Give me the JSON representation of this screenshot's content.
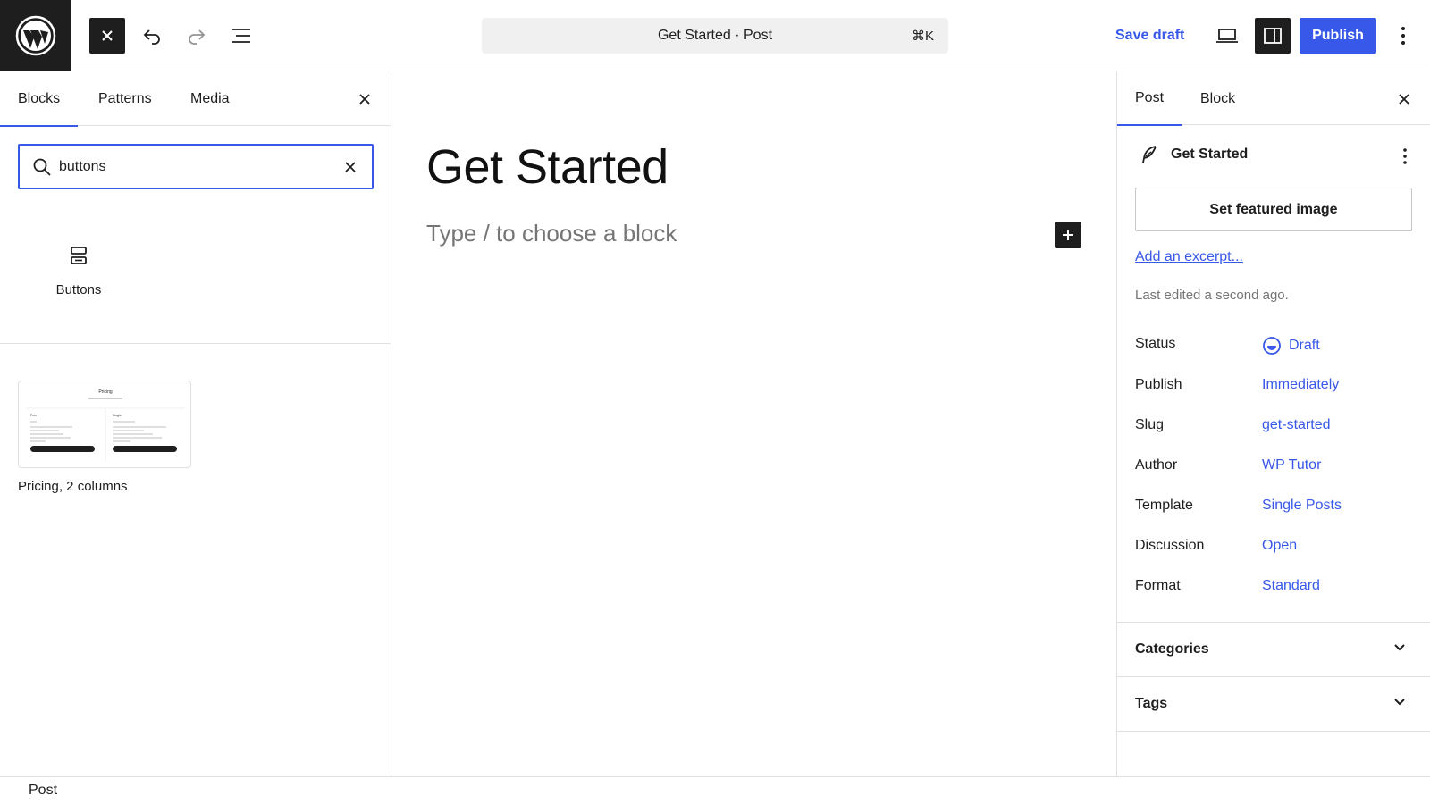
{
  "topbar": {
    "doc_title": "Get Started · Post",
    "shortcut": "⌘K",
    "save_draft": "Save draft",
    "publish": "Publish"
  },
  "inserter": {
    "tabs": [
      "Blocks",
      "Patterns",
      "Media"
    ],
    "search_value": "buttons",
    "block_result": "Buttons",
    "pattern_result": "Pricing, 2 columns",
    "pattern_preview": {
      "title": "Pricing",
      "col1": "Free",
      "col2": "Single"
    }
  },
  "editor": {
    "title": "Get Started",
    "placeholder": "Type / to choose a block"
  },
  "settings": {
    "tabs": [
      "Post",
      "Block"
    ],
    "post_title": "Get Started",
    "featured_image": "Set featured image",
    "excerpt_link": "Add an excerpt...",
    "last_edited": "Last edited a second ago.",
    "meta": [
      {
        "label": "Status",
        "value": "Draft"
      },
      {
        "label": "Publish",
        "value": "Immediately"
      },
      {
        "label": "Slug",
        "value": "get-started"
      },
      {
        "label": "Author",
        "value": "WP Tutor"
      },
      {
        "label": "Template",
        "value": "Single Posts"
      },
      {
        "label": "Discussion",
        "value": "Open"
      },
      {
        "label": "Format",
        "value": "Standard"
      }
    ],
    "sections": [
      "Categories",
      "Tags"
    ]
  },
  "footer": {
    "breadcrumb": "Post"
  },
  "colors": {
    "accent": "#3858e9",
    "dark": "#1e1e1e",
    "muted": "#757575"
  }
}
